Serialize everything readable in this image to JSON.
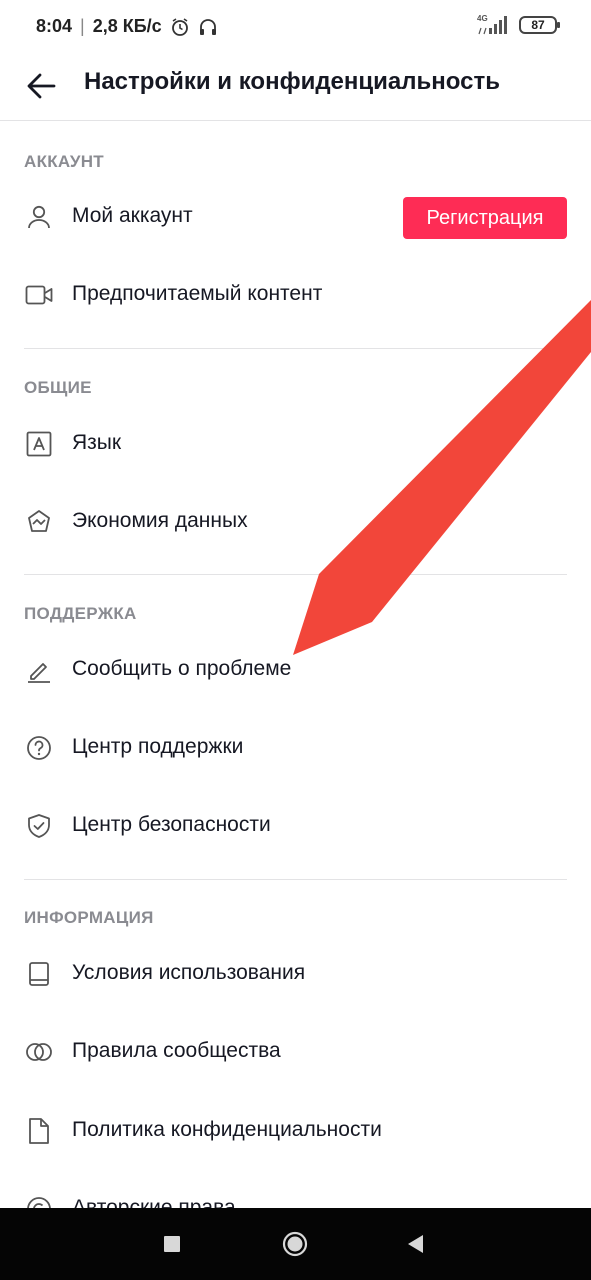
{
  "status_bar": {
    "time": "8:04",
    "separator": "|",
    "network_speed": "2,8 КБ/с",
    "network_type": "4G",
    "battery": "87"
  },
  "header": {
    "title": "Настройки и конфиденциальность"
  },
  "sections": {
    "account": {
      "title": "АККАУНТ",
      "items": [
        {
          "label": "Мой аккаунт",
          "icon": "person-icon"
        },
        {
          "label": "Предпочитаемый контент",
          "icon": "video-camera-icon"
        }
      ],
      "register_button": "Регистрация"
    },
    "general": {
      "title": "ОБЩИЕ",
      "items": [
        {
          "label": "Язык",
          "icon": "language-icon"
        },
        {
          "label": "Экономия данных",
          "icon": "data-saver-icon"
        }
      ]
    },
    "support": {
      "title": "ПОДДЕРЖКА",
      "items": [
        {
          "label": "Сообщить о проблеме",
          "icon": "pencil-icon"
        },
        {
          "label": "Центр поддержки",
          "icon": "help-circle-icon"
        },
        {
          "label": "Центр безопасности",
          "icon": "shield-check-icon"
        }
      ]
    },
    "info": {
      "title": "ИНФОРМАЦИЯ",
      "items": [
        {
          "label": "Условия использования",
          "icon": "book-icon"
        },
        {
          "label": "Правила сообщества",
          "icon": "rings-icon"
        },
        {
          "label": "Политика конфиденциальности",
          "icon": "document-icon"
        },
        {
          "label": "Авторские права",
          "icon": "copyright-icon"
        }
      ]
    }
  },
  "colors": {
    "accent": "#fe2c55",
    "annotation_arrow": "#f2463a",
    "section_title": "#8a8b91",
    "text": "#161823",
    "divider": "#e3e3e5",
    "nav_bar": "#050505"
  }
}
